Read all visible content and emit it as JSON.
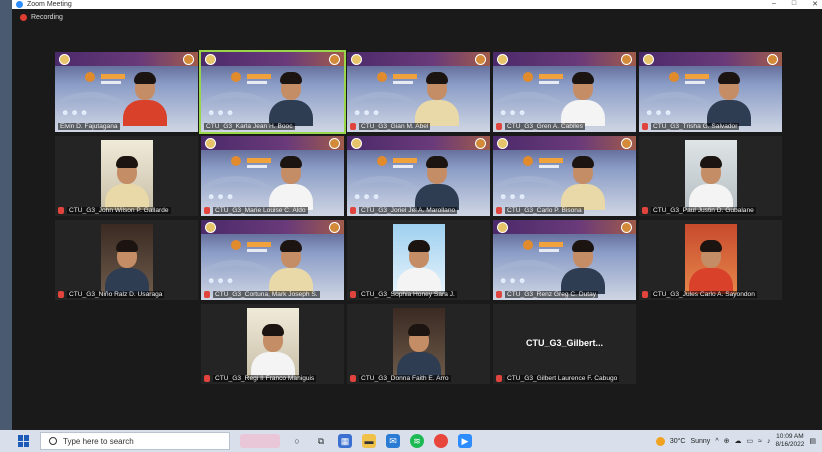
{
  "window": {
    "title": "Zoom Meeting",
    "recording_label": "Recording",
    "controls": [
      "–",
      "□",
      "✕"
    ]
  },
  "participants": [
    {
      "name": "Elvin D. Fajutagana",
      "slide": true,
      "cam": "red"
    },
    {
      "name": "CTU_G3_Karla Jean H. Booc",
      "slide": true,
      "cam": "wall",
      "active": true
    },
    {
      "name": "CTU_G3_Gian M. Abel",
      "slide": true,
      "cam": "alt"
    },
    {
      "name": "CTU_G3_Gren A. Cabiles",
      "slide": true,
      "cam": "alt"
    },
    {
      "name": "CTU_G3_Trisha G. Salvador",
      "slide": true,
      "cam": "wall"
    },
    {
      "name": "CTU_G3_John Wilson P. Gallarde",
      "slide": false,
      "cam": "wall"
    },
    {
      "name": "CTU_G3_Marie Louise C. Aldo",
      "slide": true,
      "cam": "alt"
    },
    {
      "name": "CTU_G3_Joriel Jel A. Marollano",
      "slide": true,
      "cam": "alt"
    },
    {
      "name": "CTU_G3_Carlo P. Bisona",
      "slide": true,
      "cam": "alt"
    },
    {
      "name": "CTU_G3_Paul Justin D. Gubalane",
      "slide": false,
      "cam": "alt"
    },
    {
      "name": "CTU_G3_Niño Ralz D. Usaraga",
      "slide": false,
      "cam": "dark"
    },
    {
      "name": "CTU_G3_Cortuna, Mark Joseph S.",
      "slide": true,
      "cam": "alt"
    },
    {
      "name": "CTU_G3_Sophia Honey Sara J.",
      "slide": false,
      "cam": "blue"
    },
    {
      "name": "CTU_G3_Renz Greg C. Dutay",
      "slide": true,
      "cam": "alt"
    },
    {
      "name": "CTU_G3_Jules Carlo A. Sayondon",
      "slide": false,
      "cam": "red"
    },
    {
      "name": "CTU_G3_Regi II Franco Maniguis",
      "slide": false,
      "cam": "wall"
    },
    {
      "name": "CTU_G3_Donna Faith E. Arro",
      "slide": false,
      "cam": "dark"
    },
    {
      "name": "CTU_G3_Gilbert Laurence F. Cabugo",
      "slide": false,
      "cam": "none",
      "bigname": "CTU_G3_Gilbert..."
    }
  ],
  "taskbar": {
    "search_placeholder": "Type here to search",
    "weather_temp": "30°C",
    "weather_text": "Sunny",
    "time": "10:09 AM",
    "date": "8/16/2022"
  },
  "colors": {
    "active_outline": "#9ad64a",
    "mic_muted": "#e0443c",
    "zoom_blue": "#2d8cff"
  }
}
